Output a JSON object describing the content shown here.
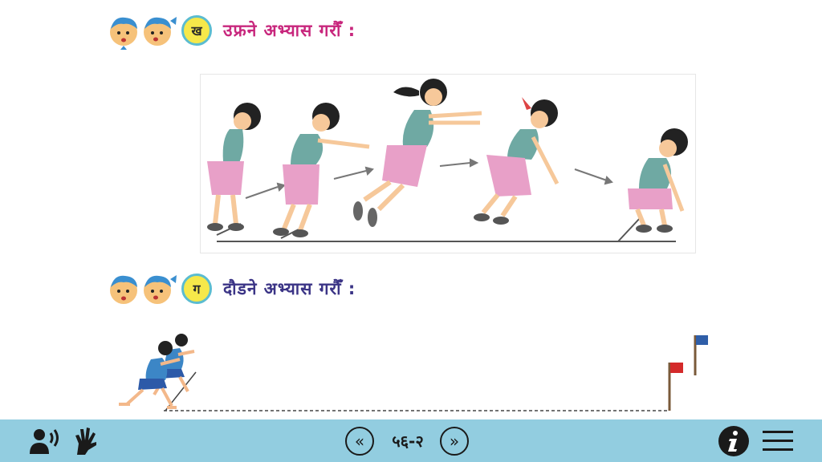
{
  "sections": [
    {
      "badge": "ख",
      "title": "उफ्रने अभ्यास गरौँ :"
    },
    {
      "badge": "ग",
      "title": "दौडने अभ्यास गरौँ :"
    }
  ],
  "footer": {
    "page_number": "५६-२",
    "prev_icon": "double-chevron-left-icon",
    "next_icon": "double-chevron-right-icon"
  },
  "colors": {
    "bar_bg": "#92cde0",
    "title1": "#c8277d",
    "title2": "#3b3486",
    "badge_fill": "#f6e84a",
    "badge_border": "#5bbcd0"
  }
}
